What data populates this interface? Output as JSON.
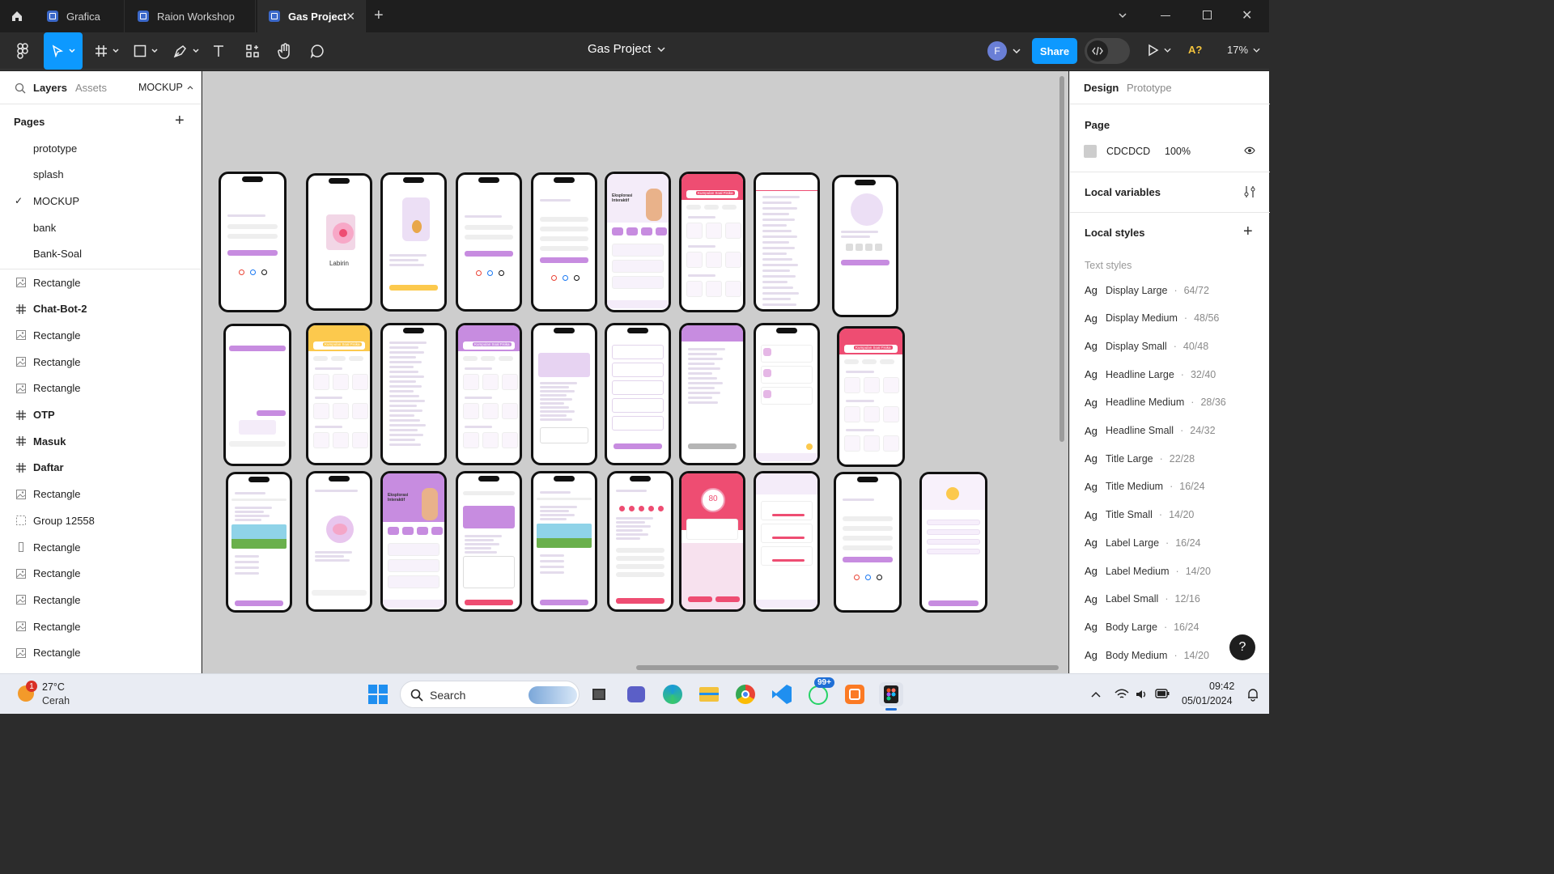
{
  "tabs": [
    {
      "label": "Grafica",
      "active": false
    },
    {
      "label": "Raion Workshop",
      "active": false
    },
    {
      "label": "Gas Project",
      "active": true
    }
  ],
  "toolbar": {
    "file_name": "Gas Project",
    "avatar_letter": "F",
    "share_label": "Share",
    "ai_label": "A?",
    "zoom": "17%"
  },
  "left_panel": {
    "tab_layers": "Layers",
    "tab_assets": "Assets",
    "page_selector": "MOCKUP",
    "pages_heading": "Pages",
    "pages": [
      {
        "name": "prototype",
        "selected": false
      },
      {
        "name": "splash",
        "selected": false
      },
      {
        "name": "MOCKUP",
        "selected": true
      },
      {
        "name": "bank",
        "selected": false
      },
      {
        "name": "Bank-Soal",
        "selected": false
      }
    ],
    "layers": [
      {
        "name": "Rectangle",
        "type": "image",
        "bold": false
      },
      {
        "name": "Chat-Bot-2",
        "type": "frame",
        "bold": true
      },
      {
        "name": "Rectangle",
        "type": "image",
        "bold": false
      },
      {
        "name": "Rectangle",
        "type": "image",
        "bold": false
      },
      {
        "name": "Rectangle",
        "type": "image",
        "bold": false
      },
      {
        "name": "OTP",
        "type": "frame",
        "bold": true
      },
      {
        "name": "Masuk",
        "type": "frame",
        "bold": true
      },
      {
        "name": "Daftar",
        "type": "frame",
        "bold": true
      },
      {
        "name": "Rectangle",
        "type": "image",
        "bold": false
      },
      {
        "name": "Group 12558",
        "type": "group",
        "bold": false
      },
      {
        "name": "Rectangle",
        "type": "rect",
        "bold": false
      },
      {
        "name": "Rectangle",
        "type": "image",
        "bold": false
      },
      {
        "name": "Rectangle",
        "type": "image",
        "bold": false
      },
      {
        "name": "Rectangle",
        "type": "image",
        "bold": false
      },
      {
        "name": "Rectangle",
        "type": "image",
        "bold": false
      }
    ]
  },
  "canvas": {
    "screens": {
      "labirin": "Labirin",
      "selamat_datang": "Selamat Datang !",
      "eksplorasi": "Eksplorasi Interaktif",
      "kumpulan_soal": "Kumpulan Soal Fisika",
      "kumpulan_materi": "Kumpulan Materi Fisika",
      "score": "80"
    }
  },
  "right_panel": {
    "tab_design": "Design",
    "tab_prototype": "Prototype",
    "page_heading": "Page",
    "page_color": "CDCDCD",
    "page_opacity": "100%",
    "local_variables": "Local variables",
    "local_styles": "Local styles",
    "text_styles_heading": "Text styles",
    "text_styles": [
      {
        "name": "Display Large",
        "size": "64/72"
      },
      {
        "name": "Display Medium",
        "size": "48/56"
      },
      {
        "name": "Display Small",
        "size": "40/48"
      },
      {
        "name": "Headline Large",
        "size": "32/40"
      },
      {
        "name": "Headline Medium",
        "size": "28/36"
      },
      {
        "name": "Headline Small",
        "size": "24/32"
      },
      {
        "name": "Title Large",
        "size": "22/28"
      },
      {
        "name": "Title Medium",
        "size": "16/24"
      },
      {
        "name": "Title Small",
        "size": "14/20"
      },
      {
        "name": "Label Large",
        "size": "16/24"
      },
      {
        "name": "Label Medium",
        "size": "14/20"
      },
      {
        "name": "Label Small",
        "size": "12/16"
      },
      {
        "name": "Body Large",
        "size": "16/24"
      },
      {
        "name": "Body Medium",
        "size": "14/20"
      }
    ],
    "help": "?"
  },
  "taskbar": {
    "weather_temp": "27°C",
    "weather_desc": "Cerah",
    "weather_badge": "1",
    "search_placeholder": "Search",
    "whatsapp_badge": "99+",
    "time": "09:42",
    "date": "05/01/2024"
  },
  "colors": {
    "accent": "#0d99ff",
    "canvas": "#CDCDCD",
    "primary_purple": "#c78ce0",
    "pink": "#ee4d72",
    "yellow": "#fcc94d"
  }
}
